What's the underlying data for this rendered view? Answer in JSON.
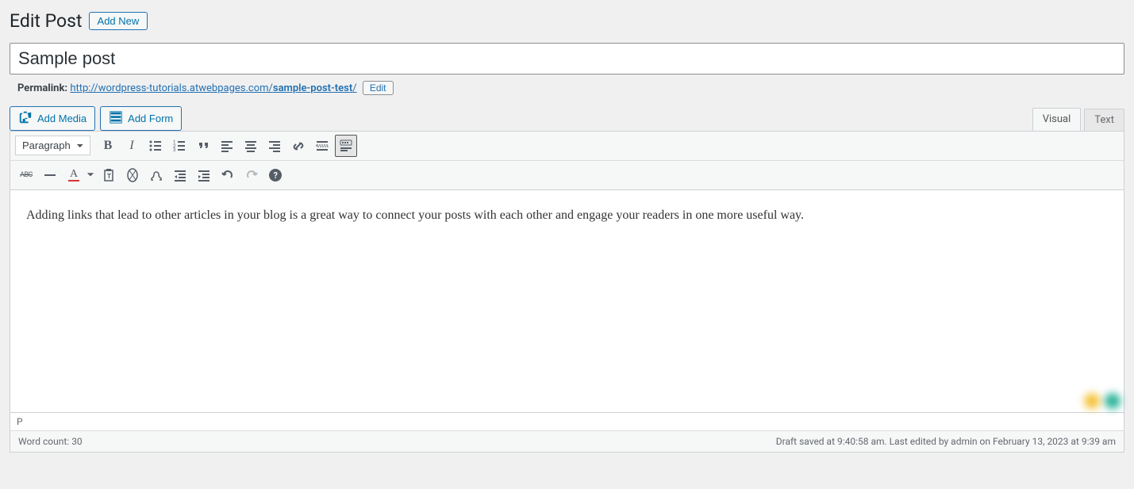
{
  "header": {
    "title": "Edit Post",
    "add_new": "Add New"
  },
  "post": {
    "title": "Sample post"
  },
  "permalink": {
    "label": "Permalink:",
    "base": "http://wordpress-tutorials.atwebpages.com/",
    "slug": "sample-post-test",
    "trail": "/",
    "edit_label": "Edit"
  },
  "media": {
    "add_media": "Add Media",
    "add_form": "Add Form"
  },
  "tabs": {
    "visual": "Visual",
    "text": "Text"
  },
  "toolbar": {
    "format": "Paragraph"
  },
  "content": "Adding links that lead to other articles in your blog is a great way to connect your posts with each other and engage your readers in one more useful way.",
  "path": "P",
  "status": {
    "word_count_label": "Word count: ",
    "word_count": "30",
    "draft_saved": "Draft saved at 9:40:58 am. Last edited by admin on February 13, 2023 at 9:39 am"
  }
}
